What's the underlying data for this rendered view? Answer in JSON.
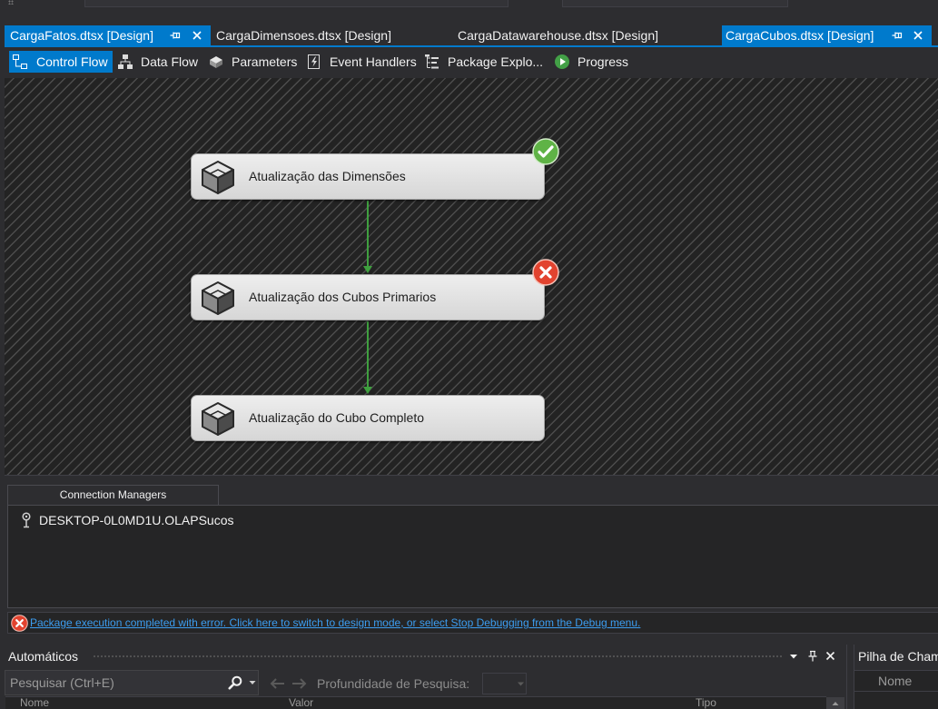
{
  "colors": {
    "accent": "#007acc",
    "success": "#5fb346",
    "error": "#e2432f",
    "connector": "#3f9f3f",
    "link": "#3c9df0"
  },
  "document_tabs": [
    {
      "label": "CargaFatos.dtsx [Design]",
      "active": true,
      "pinned": true
    },
    {
      "label": "CargaDimensoes.dtsx [Design]",
      "active": false
    },
    {
      "label": "CargaDatawarehouse.dtsx [Design]",
      "active": false
    },
    {
      "label": "CargaCubos.dtsx [Design]",
      "active": true,
      "pinned": true
    }
  ],
  "designer_tabs": [
    {
      "label": "Control Flow",
      "icon": "control-flow-icon",
      "selected": true
    },
    {
      "label": "Data Flow",
      "icon": "data-flow-icon"
    },
    {
      "label": "Parameters",
      "icon": "parameters-icon"
    },
    {
      "label": "Event Handlers",
      "icon": "event-handlers-icon"
    },
    {
      "label": "Package Explo...",
      "icon": "package-explorer-icon"
    },
    {
      "label": "Progress",
      "icon": "progress-icon"
    }
  ],
  "control_flow": {
    "tasks": [
      {
        "label": "Atualização das Dimensões",
        "icon": "cube-icon",
        "status_icon": "success-check-icon"
      },
      {
        "label": "Atualização dos Cubos Primarios",
        "icon": "cube-icon",
        "status_icon": "error-x-icon"
      },
      {
        "label": "Atualização do Cubo Completo",
        "icon": "cube-icon"
      }
    ],
    "connectors": [
      {
        "from": 0,
        "to": 1
      },
      {
        "from": 1,
        "to": 2
      }
    ]
  },
  "connection_managers": {
    "tab_label": "Connection Managers",
    "items": [
      {
        "name": "DESKTOP-0L0MD1U.OLAPSucos",
        "icon": "connection-icon"
      }
    ]
  },
  "error_bar": {
    "icon": "error-circle-icon",
    "message": "Package execution completed with error. Click here to switch to design mode, or select Stop Debugging from the Debug menu."
  },
  "autos_panel": {
    "title": "Automáticos",
    "search_placeholder": "Pesquisar (Ctrl+E)",
    "depth_label": "Profundidade de Pesquisa:",
    "columns": [
      "Nome",
      "Valor",
      "Tipo"
    ]
  },
  "call_stack_panel": {
    "title": "Pilha de Cham",
    "columns": [
      "Nome"
    ]
  }
}
